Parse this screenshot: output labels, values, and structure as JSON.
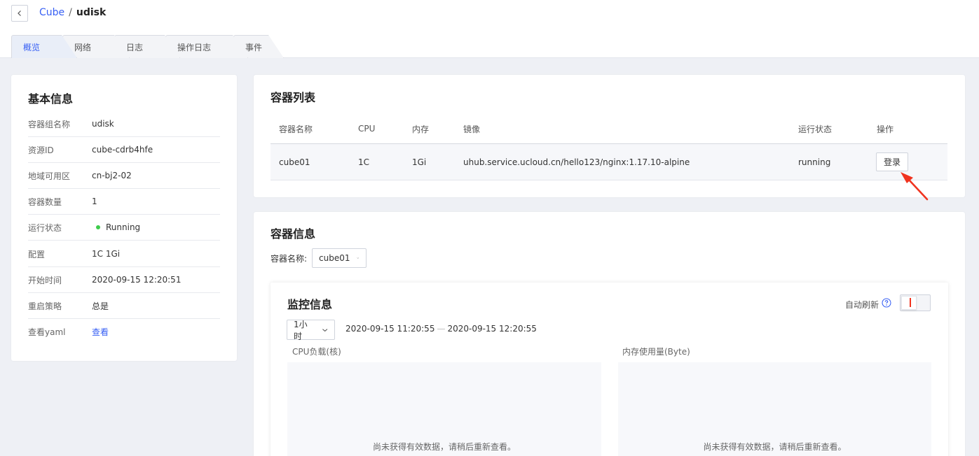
{
  "breadcrumb": {
    "parent": "Cube",
    "separator": "/",
    "current": "udisk"
  },
  "tabs": [
    {
      "label": "概览",
      "active": true
    },
    {
      "label": "网络",
      "active": false
    },
    {
      "label": "日志",
      "active": false
    },
    {
      "label": "操作日志",
      "active": false
    },
    {
      "label": "事件",
      "active": false
    }
  ],
  "basic_info": {
    "title": "基本信息",
    "rows": [
      {
        "key": "容器组名称",
        "value": "udisk"
      },
      {
        "key": "资源ID",
        "value": "cube-cdrb4hfe"
      },
      {
        "key": "地域可用区",
        "value": "cn-bj2-02"
      },
      {
        "key": "容器数量",
        "value": "1"
      },
      {
        "key": "运行状态",
        "value": "Running"
      },
      {
        "key": "配置",
        "value": "1C 1Gi"
      },
      {
        "key": "开始时间",
        "value": "2020-09-15 12:20:51"
      },
      {
        "key": "重启策略",
        "value": "总是"
      },
      {
        "key": "查看yaml",
        "value": "查看"
      }
    ],
    "status_color": "#3ecb4c"
  },
  "container_list": {
    "title": "容器列表",
    "columns": [
      "容器名称",
      "CPU",
      "内存",
      "镜像",
      "运行状态",
      "操作"
    ],
    "rows": [
      {
        "name": "cube01",
        "cpu": "1C",
        "memory": "1Gi",
        "image": "uhub.service.ucloud.cn/hello123/nginx:1.17.10-alpine",
        "status": "running",
        "action": "登录"
      }
    ]
  },
  "container_info": {
    "title": "容器信息",
    "select_label": "容器名称:",
    "selected_container": "cube01"
  },
  "monitor": {
    "title": "监控信息",
    "auto_refresh_label": "自动刷新",
    "help_icon": "question-circle-icon",
    "auto_refresh_enabled": false,
    "range_option": "1小时",
    "time_start": "2020-09-15 11:20:55",
    "time_sep": "—",
    "time_end": "2020-09-15 12:20:55",
    "charts": [
      {
        "label": "CPU负载(核)",
        "empty_text": "尚未获得有效数据，请稍后重新查看。"
      },
      {
        "label": "内存使用量(Byte)",
        "empty_text": "尚未获得有效数据，请稍后重新查看。"
      }
    ]
  },
  "colors": {
    "accent": "#3860f4",
    "annotation": "#f0331f"
  }
}
